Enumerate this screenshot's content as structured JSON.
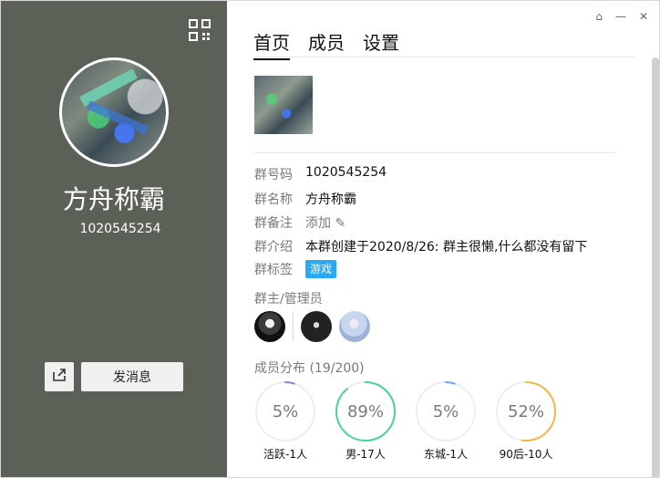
{
  "left": {
    "group_name": "方舟称霸",
    "group_id": "1020545254",
    "send_message_label": "发消息",
    "icons": [
      "qr-code-icon",
      "share-icon"
    ]
  },
  "right": {
    "tabs": [
      "首页",
      "成员",
      "设置"
    ],
    "window_controls": [
      "pin-icon",
      "minimize-icon",
      "close-icon"
    ],
    "fields": [
      {
        "label": "群号码",
        "value": "1020545254"
      },
      {
        "label": "群名称",
        "value": "方舟称霸"
      },
      {
        "label": "群备注",
        "value": "添加"
      },
      {
        "label": "群介绍",
        "value": "本群创建于2020/8/26:  群主很懒,什么都没有留下"
      },
      {
        "label": "群标签",
        "value": "游戏"
      }
    ],
    "admins_title": "群主/管理员",
    "members_title": "成员分布 (19/200)",
    "distribution": [
      {
        "percent": 5,
        "text": "5%",
        "label": "活跃-1人",
        "color": "#8a84d6"
      },
      {
        "percent": 89,
        "text": "89%",
        "label": "男-17人",
        "color": "#49d39a"
      },
      {
        "percent": 5,
        "text": "5%",
        "label": "东城-1人",
        "color": "#6aa9ff"
      },
      {
        "percent": 52,
        "text": "52%",
        "label": "90后-10人",
        "color": "#f5b64c"
      }
    ]
  },
  "colors": {
    "left_panel_bg": "#5c6157",
    "tag_bg": "#2aa8f3"
  }
}
